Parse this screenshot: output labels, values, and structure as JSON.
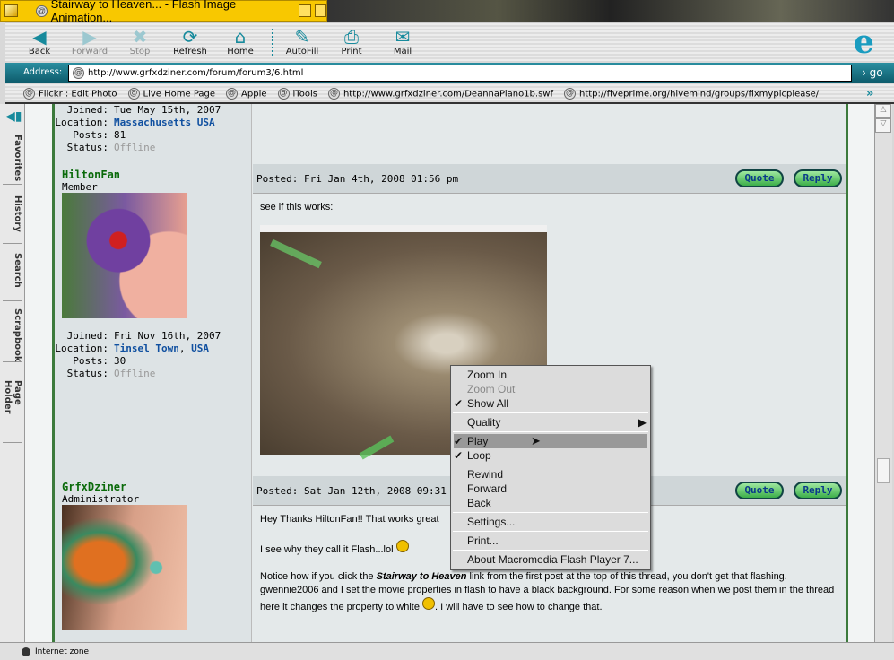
{
  "window": {
    "title": "Stairway to Heaven... - Flash Image Animation..."
  },
  "toolbar": {
    "buttons": [
      {
        "label": "Back",
        "icon": "back-arrow-icon",
        "enabled": true
      },
      {
        "label": "Forward",
        "icon": "forward-arrow-icon",
        "enabled": false
      },
      {
        "label": "Stop",
        "icon": "stop-icon",
        "enabled": false
      },
      {
        "label": "Refresh",
        "icon": "refresh-icon",
        "enabled": true
      },
      {
        "label": "Home",
        "icon": "home-icon",
        "enabled": true
      },
      {
        "label": "AutoFill",
        "icon": "autofill-icon",
        "enabled": true
      },
      {
        "label": "Print",
        "icon": "print-icon",
        "enabled": true
      },
      {
        "label": "Mail",
        "icon": "mail-icon",
        "enabled": true
      }
    ]
  },
  "address": {
    "label": "Address:",
    "url": "http://www.grfxdziner.com/forum/forum3/6.html",
    "go": "go"
  },
  "favorites": [
    "Flickr : Edit Photo",
    "Live Home Page",
    "Apple",
    "iTools",
    "http://www.grfxdziner.com/DeannaPiano1b.swf",
    "http://fiveprime.org/hivemind/groups/fixmypicplease/"
  ],
  "sidetabs": [
    "Favorites",
    "History",
    "Search",
    "Scrapbook",
    "Page Holder"
  ],
  "labels": {
    "joined": "Joined:",
    "location": "Location:",
    "posts": "Posts:",
    "status": "Status:",
    "quote": "Quote",
    "reply": "Reply"
  },
  "posts": [
    {
      "joined": "Tue May 15th, 2007",
      "location": "Massachusetts USA",
      "posts": "81",
      "status": "Offline"
    },
    {
      "user": "HiltonFan",
      "role": "Member",
      "joined": "Fri Nov 16th, 2007",
      "location_a": "Tinsel Town",
      "location_sep": ", ",
      "location_b": "USA",
      "posts": "30",
      "status": "Offline",
      "posted": "Posted: Fri Jan 4th, 2008 01:56 pm",
      "body": "see if this works:"
    },
    {
      "user": "GrfxDziner",
      "role": "Administrator",
      "posted": "Posted: Sat Jan 12th, 2008 09:31 am",
      "p1": "Hey Thanks HiltonFan!! That works great",
      "p2": "I see why they call it Flash...lol",
      "p3a": "Notice how if you click the ",
      "p3b": "Stairway to Heaven",
      "p3c": " link from the first post at the top of this thread, you don't get that flashing. gwennie2006 and I set the movie properties in flash to have a black background. For some reason when we post them in the thread here it changes the property to white ",
      "p3d": ". I will have to see how to change that."
    }
  ],
  "context_menu": {
    "items": [
      {
        "label": "Zoom In"
      },
      {
        "label": "Zoom Out",
        "disabled": true
      },
      {
        "label": "Show All",
        "checked": true
      },
      {
        "label": "Quality",
        "submenu": true
      },
      {
        "label": "Play",
        "checked": true,
        "highlighted": true
      },
      {
        "label": "Loop",
        "checked": true
      },
      {
        "label": "Rewind"
      },
      {
        "label": "Forward"
      },
      {
        "label": "Back"
      },
      {
        "label": "Settings..."
      },
      {
        "label": "Print..."
      },
      {
        "label": "About Macromedia Flash Player 7..."
      }
    ]
  },
  "status": {
    "zone": "Internet zone"
  },
  "colors": {
    "title_bar": "#f8c800",
    "accent": "#178a9c",
    "username": "#0a6a0a",
    "link": "#1050a0",
    "border": "#3c7a3c"
  }
}
